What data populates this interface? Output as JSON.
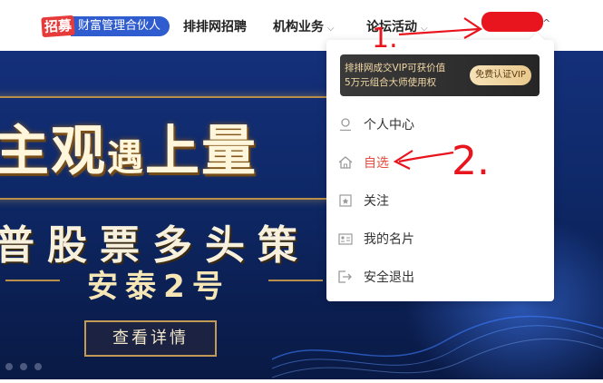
{
  "nav": {
    "recruit_tag": "招募",
    "recruit_text": "财富管理合伙人",
    "items": [
      {
        "label": "排排网招聘",
        "has_chevron": false
      },
      {
        "label": "机构业务",
        "has_chevron": true
      },
      {
        "label": "论坛活动",
        "has_chevron": true
      }
    ],
    "user_chevron": "^"
  },
  "banner": {
    "headline_part1": "主观",
    "headline_part2": "遇",
    "headline_part3": "上量",
    "subline": "普股票多头策",
    "product": "安泰2号",
    "detail_button": "查看详情"
  },
  "dropdown": {
    "vip_line1": "排排网成交VIP可获价值",
    "vip_line2": "5万元组合大师使用权",
    "vip_button": "免费认证VIP",
    "items": [
      {
        "label": "个人中心",
        "icon": "user-icon"
      },
      {
        "label": "自选",
        "icon": "home-icon",
        "active": true
      },
      {
        "label": "关注",
        "icon": "star-icon"
      },
      {
        "label": "我的名片",
        "icon": "card-icon"
      },
      {
        "label": "安全退出",
        "icon": "logout-icon"
      }
    ]
  },
  "annotations": {
    "mark1": "1.",
    "mark2": "2."
  },
  "colors": {
    "accent_red": "#e74a3a",
    "brand_blue": "#2f5ccf",
    "redaction": "#e8141e"
  }
}
